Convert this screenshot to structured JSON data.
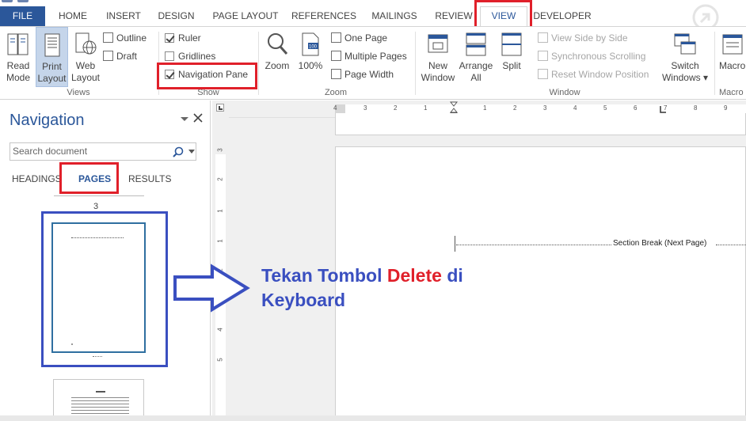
{
  "tabs": [
    {
      "label": "FILE"
    },
    {
      "label": "HOME"
    },
    {
      "label": "INSERT"
    },
    {
      "label": "DESIGN"
    },
    {
      "label": "PAGE LAYOUT"
    },
    {
      "label": "REFERENCES"
    },
    {
      "label": "MAILINGS"
    },
    {
      "label": "REVIEW"
    },
    {
      "label": "VIEW"
    },
    {
      "label": "DEVELOPER"
    }
  ],
  "ribbon": {
    "views": {
      "label": "Views",
      "read_mode": "Read Mode",
      "read_mode_l1": "Read",
      "read_mode_l2": "Mode",
      "print_l1": "Print",
      "print_l2": "Layout",
      "web_l1": "Web",
      "web_l2": "Layout",
      "outline": "Outline",
      "draft": "Draft"
    },
    "show": {
      "label": "Show",
      "ruler": "Ruler",
      "gridlines": "Gridlines",
      "navigation_pane": "Navigation Pane"
    },
    "zoom": {
      "label": "Zoom",
      "zoom": "Zoom",
      "hundred": "100%",
      "one_page": "One Page",
      "multiple_pages": "Multiple Pages",
      "page_width": "Page Width"
    },
    "window": {
      "label": "Window",
      "new_l1": "New",
      "new_l2": "Window",
      "arrange_l1": "Arrange",
      "arrange_l2": "All",
      "split": "Split",
      "view_side": "View Side by Side",
      "sync_scroll": "Synchronous Scrolling",
      "reset_pos": "Reset Window Position",
      "switch_l1": "Switch",
      "switch_l2": "Windows ▾"
    },
    "macro": {
      "label": "Macro",
      "macros": "Macro"
    }
  },
  "navigation": {
    "title": "Navigation",
    "search_placeholder": "Search document",
    "tabs": [
      "HEADINGS",
      "PAGES",
      "RESULTS"
    ],
    "page_number": "3"
  },
  "document": {
    "section_break": "Section Break (Next Page)",
    "vruler_numbers": [
      "3",
      "2",
      "1",
      "1",
      "2",
      "3",
      "4",
      "5"
    ],
    "hruler_numbers": [
      "4",
      "3",
      "2",
      "1",
      "1",
      "2",
      "3",
      "4",
      "5",
      "6",
      "7",
      "8",
      "9"
    ]
  },
  "annotation": {
    "part1": "Tekan Tombol",
    "highlight": "Delete",
    "part2": "di",
    "line2": "Keyboard"
  },
  "colors": {
    "accent": "#2b579a",
    "highlight_red": "#e0202a",
    "annotation_blue": "#3a4fc0"
  }
}
